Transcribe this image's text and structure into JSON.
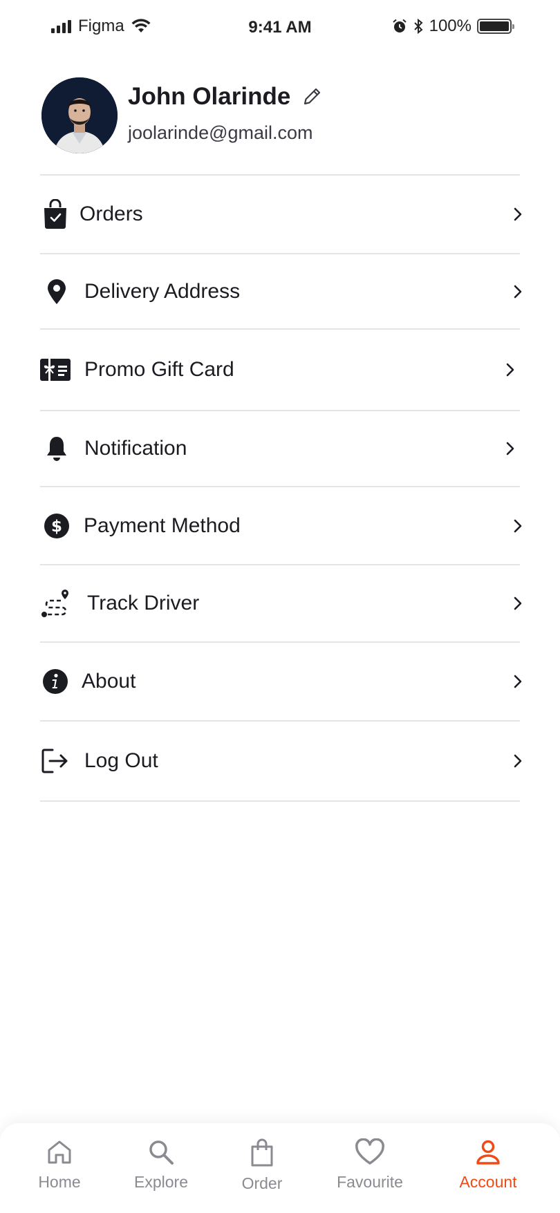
{
  "status_bar": {
    "carrier": "Figma",
    "time": "9:41 AM",
    "battery": "100%"
  },
  "profile": {
    "name": "John Olarinde",
    "email": "joolarinde@gmail.com"
  },
  "menu": {
    "items": [
      {
        "label": "Orders",
        "icon": "shopping-bag-icon"
      },
      {
        "label": "Delivery Address",
        "icon": "location-pin-icon"
      },
      {
        "label": "Promo Gift Card",
        "icon": "gift-card-icon"
      },
      {
        "label": "Notification",
        "icon": "bell-icon"
      },
      {
        "label": "Payment Method",
        "icon": "dollar-icon"
      },
      {
        "label": "Track Driver",
        "icon": "route-icon"
      },
      {
        "label": "About",
        "icon": "info-icon"
      },
      {
        "label": "Log Out",
        "icon": "logout-icon"
      }
    ]
  },
  "bottom_nav": {
    "items": [
      {
        "label": "Home",
        "icon": "home-icon",
        "active": false
      },
      {
        "label": "Explore",
        "icon": "search-icon",
        "active": false
      },
      {
        "label": "Order",
        "icon": "bag-icon",
        "active": false
      },
      {
        "label": "Favourite",
        "icon": "heart-icon",
        "active": false
      },
      {
        "label": "Account",
        "icon": "user-icon",
        "active": true
      }
    ]
  },
  "colors": {
    "accent": "#f04a16",
    "text": "#1b1b22",
    "muted": "#8a8a90",
    "divider": "#e4e4e6"
  }
}
